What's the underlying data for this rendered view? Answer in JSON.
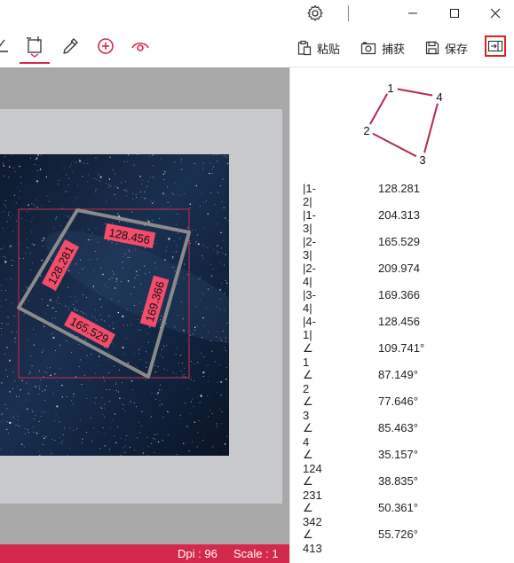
{
  "toolbar": {
    "paste_label": "粘贴",
    "capture_label": "捕获",
    "save_label": "保存"
  },
  "canvas": {
    "labels": {
      "side_1_2": "128.281",
      "side_4_1": "128.456",
      "side_3_4": "169.366",
      "side_2_3": "165.529"
    }
  },
  "diagram": {
    "points": [
      "1",
      "2",
      "3",
      "4"
    ]
  },
  "measurements": [
    {
      "label": "|1-2|",
      "value": "128.281"
    },
    {
      "label": "|1-3|",
      "value": "204.313"
    },
    {
      "label": "|2-3|",
      "value": "165.529"
    },
    {
      "label": "|2-4|",
      "value": "209.974"
    },
    {
      "label": "|3-4|",
      "value": "169.366"
    },
    {
      "label": "|4-1|",
      "value": "128.456"
    },
    {
      "label": "∠ 1",
      "value": "109.741°"
    },
    {
      "label": "∠ 2",
      "value": "87.149°"
    },
    {
      "label": "∠ 3",
      "value": "77.646°"
    },
    {
      "label": "∠ 4",
      "value": "85.463°"
    },
    {
      "label": "∠ 124",
      "value": "35.157°"
    },
    {
      "label": "∠ 231",
      "value": "38.835°"
    },
    {
      "label": "∠ 342",
      "value": "50.361°"
    },
    {
      "label": "∠ 413",
      "value": "55.726°"
    }
  ],
  "status": {
    "dpi": "Dpi : 96",
    "scale": "Scale : 1"
  },
  "colors": {
    "accent": "#d4294b",
    "label_fill": "#f24d6b",
    "shape_stroke": "#8a8a8a",
    "bbox_stroke": "#b5294a"
  }
}
